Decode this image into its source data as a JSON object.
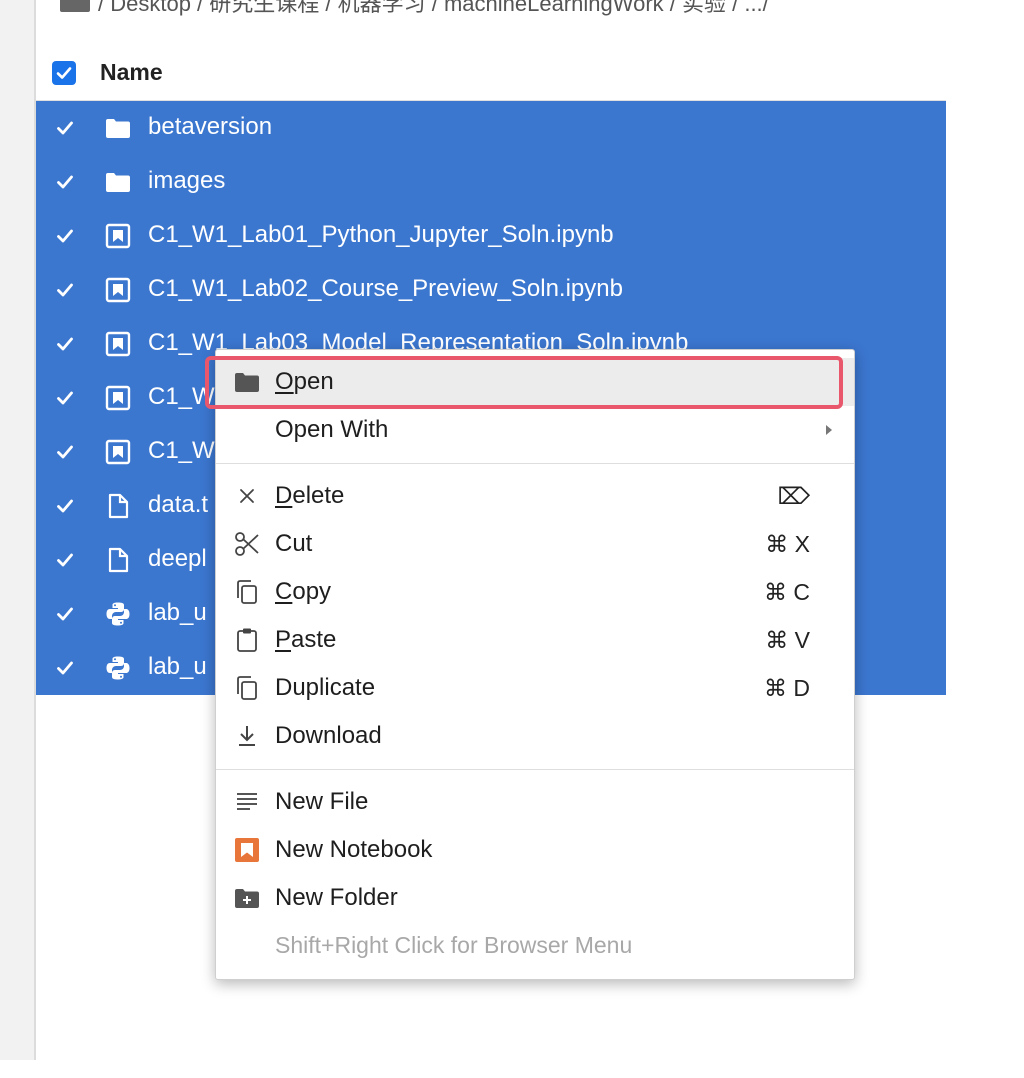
{
  "breadcrumb": {
    "text": "/ Desktop / 研究生课程 / 机器学习 / machineLearningWork / 实验 / .../"
  },
  "header": {
    "name_label": "Name"
  },
  "files": [
    {
      "name": "betaversion",
      "icon": "folder-icon"
    },
    {
      "name": "images",
      "icon": "folder-icon"
    },
    {
      "name": "C1_W1_Lab01_Python_Jupyter_Soln.ipynb",
      "icon": "notebook-icon"
    },
    {
      "name": "C1_W1_Lab02_Course_Preview_Soln.ipynb",
      "icon": "notebook-icon"
    },
    {
      "name": "C1_W1_Lab03_Model_Representation_Soln.ipynb",
      "icon": "notebook-icon"
    },
    {
      "name": "C1_W",
      "icon": "notebook-icon"
    },
    {
      "name": "C1_W",
      "icon": "notebook-icon"
    },
    {
      "name": "data.t",
      "icon": "file-icon"
    },
    {
      "name": "deepl",
      "icon": "file-icon"
    },
    {
      "name": "lab_u",
      "icon": "python-icon"
    },
    {
      "name": "lab_u",
      "icon": "python-icon"
    }
  ],
  "menu": {
    "open": {
      "label": "Open",
      "underline": "O",
      "rest": "pen"
    },
    "open_with": {
      "label": "Open With"
    },
    "delete": {
      "label": "Delete",
      "underline": "D",
      "rest": "elete",
      "shortcut": "⌦"
    },
    "cut": {
      "label": "Cut",
      "shortcut": "⌘ X"
    },
    "copy": {
      "label": "Copy",
      "underline": "C",
      "rest": "opy",
      "shortcut": "⌘ C"
    },
    "paste": {
      "label": "Paste",
      "underline": "P",
      "rest": "aste",
      "shortcut": "⌘ V"
    },
    "duplicate": {
      "label": "Duplicate",
      "shortcut": "⌘ D"
    },
    "download": {
      "label": "Download"
    },
    "new_file": {
      "label": "New File"
    },
    "new_notebook": {
      "label": "New Notebook"
    },
    "new_folder": {
      "label": "New Folder"
    },
    "hint": "Shift+Right Click for Browser Menu"
  },
  "colors": {
    "selection": "#3b76cf",
    "checkbox": "#1a73e8",
    "highlight_border": "#e8576b",
    "notebook_orange": "#e8753a"
  }
}
